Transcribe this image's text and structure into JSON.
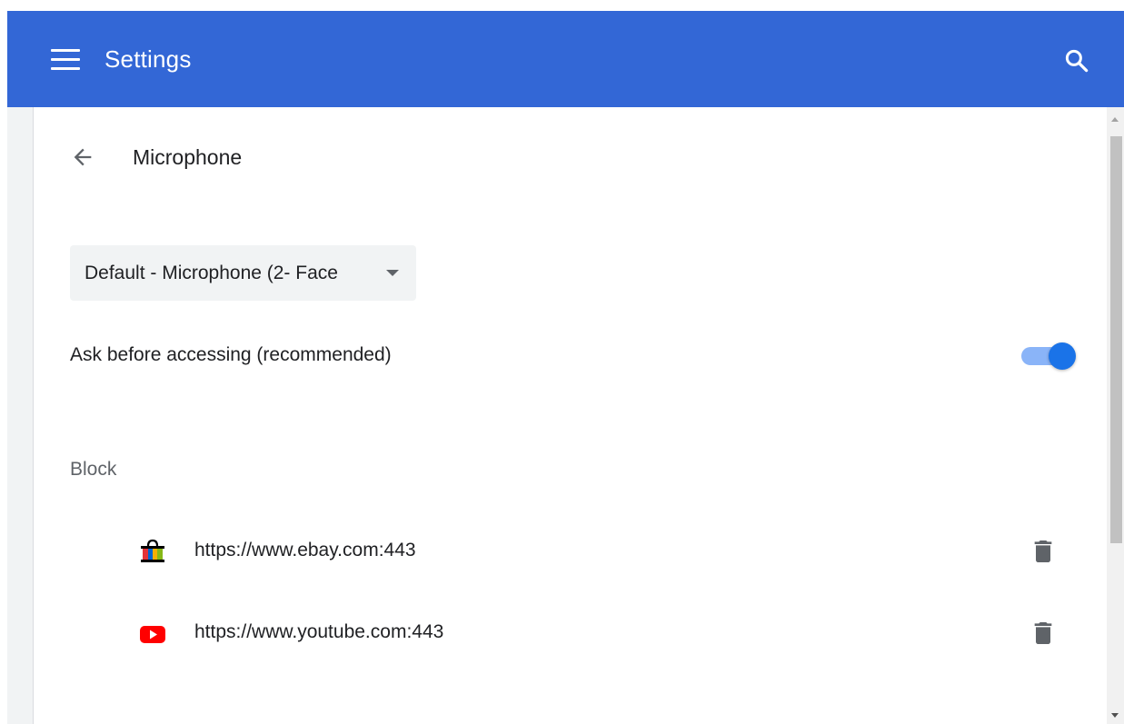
{
  "header": {
    "title": "Settings",
    "menu_icon": "hamburger-menu-icon",
    "search_icon": "search-icon",
    "background_color": "#3367d6"
  },
  "page": {
    "back_icon": "arrow-back-icon",
    "title": "Microphone"
  },
  "device_select": {
    "selected_value": "Default - Microphone (2- Face",
    "caret_icon": "caret-down-icon"
  },
  "ask_setting": {
    "label": "Ask before accessing (recommended)",
    "enabled": true,
    "accent_color": "#1a73e8"
  },
  "block": {
    "heading": "Block",
    "sites": [
      {
        "url": "https://www.ebay.com:443",
        "favicon": "ebay-favicon-icon",
        "delete_icon": "trash-icon"
      },
      {
        "url": "https://www.youtube.com:443",
        "favicon": "youtube-favicon-icon",
        "delete_icon": "trash-icon"
      }
    ]
  }
}
